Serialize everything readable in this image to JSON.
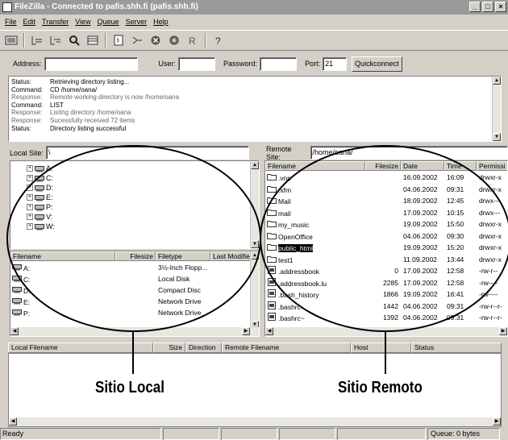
{
  "window": {
    "title": "FileZilla - Connected to pafis.shh.fi (pafis.shh.fi)",
    "min": "_",
    "max": "□",
    "close": "×"
  },
  "menu": [
    "File",
    "Edit",
    "Transfer",
    "View",
    "Queue",
    "Server",
    "Help"
  ],
  "toolbar_icons": [
    "site-manager-icon",
    "toggle-log-icon",
    "toggle-local-tree-icon",
    "toggle-remote-tree-icon",
    "toggle-queue-icon",
    "refresh-icon",
    "process-queue-icon",
    "cancel-icon",
    "disconnect-icon",
    "reconnect-icon",
    "help-icon"
  ],
  "quickconnect": {
    "address_label": "Address:",
    "address_value": "",
    "user_label": "User:",
    "user_value": "",
    "password_label": "Password:",
    "password_value": "",
    "port_label": "Port:",
    "port_value": "21",
    "button": "Quickconnect"
  },
  "log": [
    {
      "k": "Status:",
      "v": "Retrieving directory listing...",
      "type": "status"
    },
    {
      "k": "Command:",
      "v": "CD /home/oana/",
      "type": "command"
    },
    {
      "k": "Response:",
      "v": "Remote working directory is now /home/oana",
      "type": "response"
    },
    {
      "k": "Command:",
      "v": "LIST",
      "type": "command"
    },
    {
      "k": "Response:",
      "v": "Listing directory /home/oana",
      "type": "response"
    },
    {
      "k": "Response:",
      "v": "Sucessfully received 72 items",
      "type": "response"
    },
    {
      "k": "Status:",
      "v": "Directory listing successful",
      "type": "status"
    }
  ],
  "local": {
    "site_label": "Local Site:",
    "site_value": "\\",
    "tree": [
      "A:",
      "C:",
      "D:",
      "E:",
      "P:",
      "V:",
      "W:"
    ],
    "columns": [
      "Filename",
      "Filesize",
      "Filetype",
      "Last Modified"
    ],
    "files": [
      {
        "name": "A:",
        "size": "",
        "type": "3½-Inch Flopp...",
        "modified": ""
      },
      {
        "name": "C:",
        "size": "",
        "type": "Local Disk",
        "modified": ""
      },
      {
        "name": "D:",
        "size": "",
        "type": "Compact Disc",
        "modified": ""
      },
      {
        "name": "E:",
        "size": "",
        "type": "Network Drive",
        "modified": ""
      },
      {
        "name": "P:",
        "size": "",
        "type": "Network Drive",
        "modified": ""
      }
    ]
  },
  "remote": {
    "site_label": "Remote Site:",
    "site_value": "/home/oana/",
    "columns": [
      "Filename",
      "Filesize",
      "Date",
      "Time",
      "Permissi"
    ],
    "files": [
      {
        "name": ".vnc",
        "size": "",
        "date": "16.09.2002",
        "time": "16:09",
        "perm": "drwxr-x",
        "kind": "folder"
      },
      {
        "name": ".xfm",
        "size": "",
        "date": "04.06.2002",
        "time": "09:31",
        "perm": "drwxr-x",
        "kind": "folder"
      },
      {
        "name": "Mail",
        "size": "",
        "date": "18.09.2002",
        "time": "12:45",
        "perm": "drwx---",
        "kind": "folder"
      },
      {
        "name": "mail",
        "size": "",
        "date": "17.09.2002",
        "time": "10:15",
        "perm": "drwx---",
        "kind": "folder"
      },
      {
        "name": "my_music",
        "size": "",
        "date": "19.09.2002",
        "time": "15:50",
        "perm": "drwxr-x",
        "kind": "folder"
      },
      {
        "name": "OpenOffice",
        "size": "",
        "date": "04.06.2002",
        "time": "09:30",
        "perm": "drwxr-x",
        "kind": "folder"
      },
      {
        "name": "public_html",
        "size": "",
        "date": "19.09.2002",
        "time": "15:20",
        "perm": "drwxr-x",
        "kind": "folder",
        "selected": true
      },
      {
        "name": "test1",
        "size": "",
        "date": "11.09.2002",
        "time": "13:44",
        "perm": "drwxr-x",
        "kind": "folder"
      },
      {
        "name": ".addressbook",
        "size": "0",
        "date": "17.09.2002",
        "time": "12:58",
        "perm": "-rw-r--",
        "kind": "file"
      },
      {
        "name": ".addressbook.lu",
        "size": "2285",
        "date": "17.09.2002",
        "time": "12:58",
        "perm": "-rw----",
        "kind": "file"
      },
      {
        "name": ".bash_history",
        "size": "1866",
        "date": "19.09.2002",
        "time": "16:41",
        "perm": "-rw----",
        "kind": "file"
      },
      {
        "name": ".bashrc",
        "size": "1442",
        "date": "04.06.2002",
        "time": "09:31",
        "perm": "-rw-r--r-",
        "kind": "file"
      },
      {
        "name": ".bashrc~",
        "size": "1392",
        "date": "04.06.2002",
        "time": "09:31",
        "perm": "-rw-r--r-",
        "kind": "file"
      }
    ]
  },
  "queue": {
    "columns": [
      "Local Filename",
      "Size",
      "Direction",
      "Remote Filename",
      "Host",
      "Status"
    ]
  },
  "statusbar": {
    "left": "Ready",
    "queue": "Queue: 0 bytes"
  },
  "captions": {
    "local": "Sitio Local",
    "remote": "Sitio Remoto"
  }
}
